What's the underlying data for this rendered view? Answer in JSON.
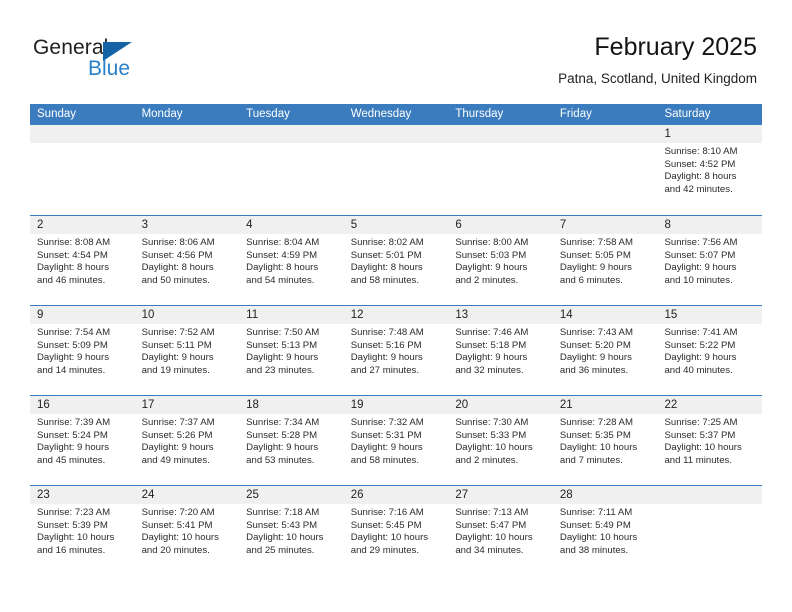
{
  "brand": {
    "name_dark": "General",
    "name_blue": "Blue",
    "accent_blue": "#2a7fc9",
    "triangle_blue": "#1464a5"
  },
  "header": {
    "title": "February 2025",
    "subtitle": "Patna, Scotland, United Kingdom"
  },
  "theme": {
    "header_row_bg": "#3b7cbf",
    "daynum_bg": "#f0f0f0",
    "text": "#222222"
  },
  "weekdays": [
    "Sunday",
    "Monday",
    "Tuesday",
    "Wednesday",
    "Thursday",
    "Friday",
    "Saturday"
  ],
  "weeks": [
    [
      {
        "day": "",
        "sunrise": "",
        "sunset": "",
        "daylight_line1": "",
        "daylight_line2": ""
      },
      {
        "day": "",
        "sunrise": "",
        "sunset": "",
        "daylight_line1": "",
        "daylight_line2": ""
      },
      {
        "day": "",
        "sunrise": "",
        "sunset": "",
        "daylight_line1": "",
        "daylight_line2": ""
      },
      {
        "day": "",
        "sunrise": "",
        "sunset": "",
        "daylight_line1": "",
        "daylight_line2": ""
      },
      {
        "day": "",
        "sunrise": "",
        "sunset": "",
        "daylight_line1": "",
        "daylight_line2": ""
      },
      {
        "day": "",
        "sunrise": "",
        "sunset": "",
        "daylight_line1": "",
        "daylight_line2": ""
      },
      {
        "day": "1",
        "sunrise": "Sunrise: 8:10 AM",
        "sunset": "Sunset: 4:52 PM",
        "daylight_line1": "Daylight: 8 hours",
        "daylight_line2": "and 42 minutes."
      }
    ],
    [
      {
        "day": "2",
        "sunrise": "Sunrise: 8:08 AM",
        "sunset": "Sunset: 4:54 PM",
        "daylight_line1": "Daylight: 8 hours",
        "daylight_line2": "and 46 minutes."
      },
      {
        "day": "3",
        "sunrise": "Sunrise: 8:06 AM",
        "sunset": "Sunset: 4:56 PM",
        "daylight_line1": "Daylight: 8 hours",
        "daylight_line2": "and 50 minutes."
      },
      {
        "day": "4",
        "sunrise": "Sunrise: 8:04 AM",
        "sunset": "Sunset: 4:59 PM",
        "daylight_line1": "Daylight: 8 hours",
        "daylight_line2": "and 54 minutes."
      },
      {
        "day": "5",
        "sunrise": "Sunrise: 8:02 AM",
        "sunset": "Sunset: 5:01 PM",
        "daylight_line1": "Daylight: 8 hours",
        "daylight_line2": "and 58 minutes."
      },
      {
        "day": "6",
        "sunrise": "Sunrise: 8:00 AM",
        "sunset": "Sunset: 5:03 PM",
        "daylight_line1": "Daylight: 9 hours",
        "daylight_line2": "and 2 minutes."
      },
      {
        "day": "7",
        "sunrise": "Sunrise: 7:58 AM",
        "sunset": "Sunset: 5:05 PM",
        "daylight_line1": "Daylight: 9 hours",
        "daylight_line2": "and 6 minutes."
      },
      {
        "day": "8",
        "sunrise": "Sunrise: 7:56 AM",
        "sunset": "Sunset: 5:07 PM",
        "daylight_line1": "Daylight: 9 hours",
        "daylight_line2": "and 10 minutes."
      }
    ],
    [
      {
        "day": "9",
        "sunrise": "Sunrise: 7:54 AM",
        "sunset": "Sunset: 5:09 PM",
        "daylight_line1": "Daylight: 9 hours",
        "daylight_line2": "and 14 minutes."
      },
      {
        "day": "10",
        "sunrise": "Sunrise: 7:52 AM",
        "sunset": "Sunset: 5:11 PM",
        "daylight_line1": "Daylight: 9 hours",
        "daylight_line2": "and 19 minutes."
      },
      {
        "day": "11",
        "sunrise": "Sunrise: 7:50 AM",
        "sunset": "Sunset: 5:13 PM",
        "daylight_line1": "Daylight: 9 hours",
        "daylight_line2": "and 23 minutes."
      },
      {
        "day": "12",
        "sunrise": "Sunrise: 7:48 AM",
        "sunset": "Sunset: 5:16 PM",
        "daylight_line1": "Daylight: 9 hours",
        "daylight_line2": "and 27 minutes."
      },
      {
        "day": "13",
        "sunrise": "Sunrise: 7:46 AM",
        "sunset": "Sunset: 5:18 PM",
        "daylight_line1": "Daylight: 9 hours",
        "daylight_line2": "and 32 minutes."
      },
      {
        "day": "14",
        "sunrise": "Sunrise: 7:43 AM",
        "sunset": "Sunset: 5:20 PM",
        "daylight_line1": "Daylight: 9 hours",
        "daylight_line2": "and 36 minutes."
      },
      {
        "day": "15",
        "sunrise": "Sunrise: 7:41 AM",
        "sunset": "Sunset: 5:22 PM",
        "daylight_line1": "Daylight: 9 hours",
        "daylight_line2": "and 40 minutes."
      }
    ],
    [
      {
        "day": "16",
        "sunrise": "Sunrise: 7:39 AM",
        "sunset": "Sunset: 5:24 PM",
        "daylight_line1": "Daylight: 9 hours",
        "daylight_line2": "and 45 minutes."
      },
      {
        "day": "17",
        "sunrise": "Sunrise: 7:37 AM",
        "sunset": "Sunset: 5:26 PM",
        "daylight_line1": "Daylight: 9 hours",
        "daylight_line2": "and 49 minutes."
      },
      {
        "day": "18",
        "sunrise": "Sunrise: 7:34 AM",
        "sunset": "Sunset: 5:28 PM",
        "daylight_line1": "Daylight: 9 hours",
        "daylight_line2": "and 53 minutes."
      },
      {
        "day": "19",
        "sunrise": "Sunrise: 7:32 AM",
        "sunset": "Sunset: 5:31 PM",
        "daylight_line1": "Daylight: 9 hours",
        "daylight_line2": "and 58 minutes."
      },
      {
        "day": "20",
        "sunrise": "Sunrise: 7:30 AM",
        "sunset": "Sunset: 5:33 PM",
        "daylight_line1": "Daylight: 10 hours",
        "daylight_line2": "and 2 minutes."
      },
      {
        "day": "21",
        "sunrise": "Sunrise: 7:28 AM",
        "sunset": "Sunset: 5:35 PM",
        "daylight_line1": "Daylight: 10 hours",
        "daylight_line2": "and 7 minutes."
      },
      {
        "day": "22",
        "sunrise": "Sunrise: 7:25 AM",
        "sunset": "Sunset: 5:37 PM",
        "daylight_line1": "Daylight: 10 hours",
        "daylight_line2": "and 11 minutes."
      }
    ],
    [
      {
        "day": "23",
        "sunrise": "Sunrise: 7:23 AM",
        "sunset": "Sunset: 5:39 PM",
        "daylight_line1": "Daylight: 10 hours",
        "daylight_line2": "and 16 minutes."
      },
      {
        "day": "24",
        "sunrise": "Sunrise: 7:20 AM",
        "sunset": "Sunset: 5:41 PM",
        "daylight_line1": "Daylight: 10 hours",
        "daylight_line2": "and 20 minutes."
      },
      {
        "day": "25",
        "sunrise": "Sunrise: 7:18 AM",
        "sunset": "Sunset: 5:43 PM",
        "daylight_line1": "Daylight: 10 hours",
        "daylight_line2": "and 25 minutes."
      },
      {
        "day": "26",
        "sunrise": "Sunrise: 7:16 AM",
        "sunset": "Sunset: 5:45 PM",
        "daylight_line1": "Daylight: 10 hours",
        "daylight_line2": "and 29 minutes."
      },
      {
        "day": "27",
        "sunrise": "Sunrise: 7:13 AM",
        "sunset": "Sunset: 5:47 PM",
        "daylight_line1": "Daylight: 10 hours",
        "daylight_line2": "and 34 minutes."
      },
      {
        "day": "28",
        "sunrise": "Sunrise: 7:11 AM",
        "sunset": "Sunset: 5:49 PM",
        "daylight_line1": "Daylight: 10 hours",
        "daylight_line2": "and 38 minutes."
      },
      {
        "day": "",
        "sunrise": "",
        "sunset": "",
        "daylight_line1": "",
        "daylight_line2": ""
      }
    ]
  ]
}
